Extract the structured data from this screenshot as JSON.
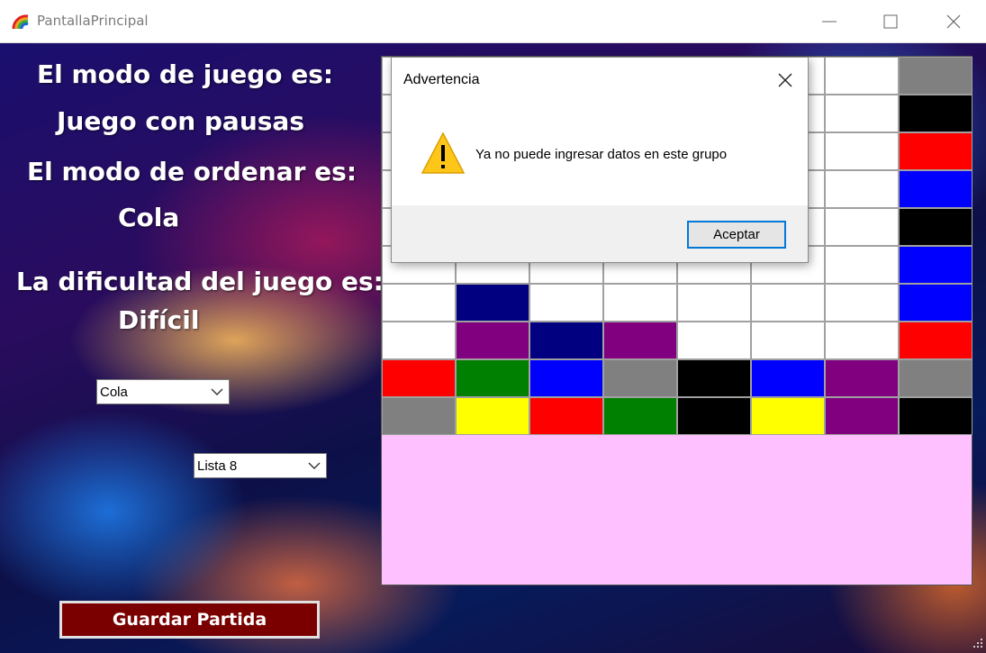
{
  "window": {
    "title": "PantallaPrincipal"
  },
  "info": {
    "game_mode_label": "El modo de juego es:",
    "game_mode_value": "Juego con pausas",
    "order_mode_label": "El modo de ordenar es:",
    "order_mode_value": "Cola",
    "difficulty_label": "La dificultad del juego es:",
    "difficulty_value": "Difícil"
  },
  "controls": {
    "order_select_value": "Cola",
    "list_select_value": "Lista 8",
    "save_button_label": "Guardar Partida"
  },
  "colors": {
    "G": "#808080",
    "K": "#000000",
    "R": "#ff0000",
    "B": "#0000ff",
    "N": "#000080",
    "P": "#800080",
    "E": "#008000",
    "Y": "#ffff00",
    "W": "#ffffff",
    "board_background": "#ffc0ff",
    "save_button": "#7a0000",
    "dialog_accent": "#0078d7"
  },
  "board": {
    "cols": 8,
    "rows": 10,
    "cells": [
      [
        "W",
        "W",
        "W",
        "W",
        "W",
        "W",
        "W",
        "G"
      ],
      [
        "W",
        "W",
        "W",
        "W",
        "W",
        "W",
        "W",
        "K"
      ],
      [
        "W",
        "W",
        "W",
        "W",
        "W",
        "W",
        "W",
        "R"
      ],
      [
        "W",
        "W",
        "W",
        "W",
        "W",
        "W",
        "W",
        "B"
      ],
      [
        "W",
        "W",
        "W",
        "W",
        "W",
        "W",
        "W",
        "K"
      ],
      [
        "W",
        "W",
        "W",
        "W",
        "W",
        "W",
        "W",
        "B"
      ],
      [
        "W",
        "N",
        "W",
        "W",
        "W",
        "W",
        "W",
        "B"
      ],
      [
        "W",
        "P",
        "N",
        "P",
        "W",
        "W",
        "W",
        "R"
      ],
      [
        "R",
        "E",
        "B",
        "G",
        "K",
        "B",
        "P",
        "G"
      ],
      [
        "G",
        "Y",
        "R",
        "E",
        "K",
        "Y",
        "P",
        "K"
      ]
    ]
  },
  "dialog": {
    "title": "Advertencia",
    "message": "Ya no puede ingresar datos en este grupo",
    "ok_label": "Aceptar",
    "icon": "warning-icon"
  }
}
